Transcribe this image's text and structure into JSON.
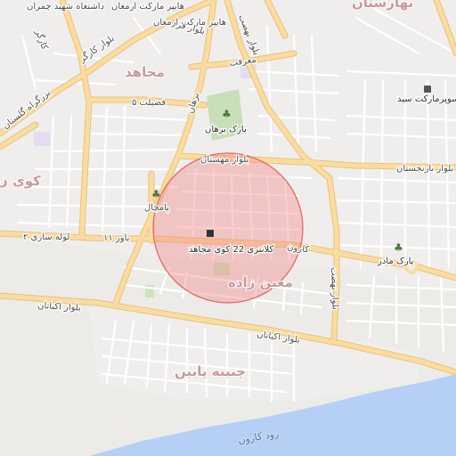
{
  "map": {
    "colors": {
      "background": "#ecebe7",
      "major_road": "#fbdca0",
      "major_road_edge": "#e9c27a",
      "minor_road": "#ffffff",
      "park": "#c8dfb8",
      "water": "#b5d0f4",
      "radius_fill": "#f08a8a",
      "radius_stroke": "#e06565"
    },
    "labels": {
      "top_left": "داشتغاه شهید چمران",
      "top_market": "هایپر مارکت ارمغان",
      "top_right": "بهارستان",
      "kargar": "بلوار کارگر",
      "kargar_short": "کارگر",
      "bozorgrah": "بزرگراه گلستان",
      "mojahed": "مجاهد",
      "fazilat": "فضیلت ۵",
      "farhang": "بلوار فر",
      "baborhan": "برهان",
      "maaref": "معرفت",
      "nahzat_top": "بلوار نهضت",
      "nahzat_bottom": "بلوار نهضت",
      "park_borhan": "پارک برهان",
      "supermarket": "سوپرمارکت سید",
      "mahastan": "بلوار مهستان",
      "naranjestan": "بلوار نارنجستان",
      "pamchal": "پامچال",
      "lole_sazi": "لوله سازی ۲",
      "yavar": "یاور ۱۱",
      "karun_st": "کارون",
      "police": "کلانتری 22 کوی مجاهد",
      "moin_zade": "معین زاده",
      "park_madar": "پارک مادر",
      "akbatan_left": "بلوار اکباتان",
      "akbatan_right": "بلوار اکباتان",
      "chonibe": "چنیبه پایین",
      "river": "رود کارون",
      "koye": "کوی ن"
    }
  }
}
